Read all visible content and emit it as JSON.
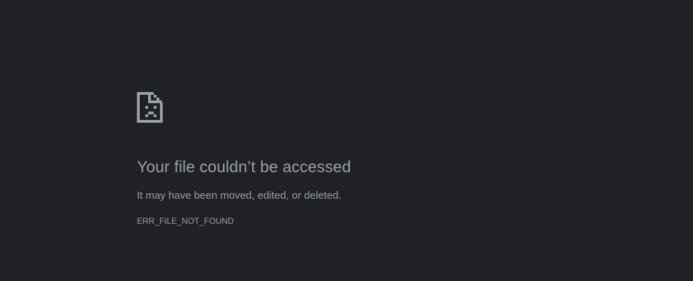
{
  "error": {
    "icon": "sad-file-icon",
    "title": "Your file couldn’t be accessed",
    "message": "It may have been moved, edited, or deleted.",
    "code": "ERR_FILE_NOT_FOUND"
  },
  "colors": {
    "background": "#202124",
    "text": "#9aa0a6",
    "icon": "#9aa0a6"
  }
}
